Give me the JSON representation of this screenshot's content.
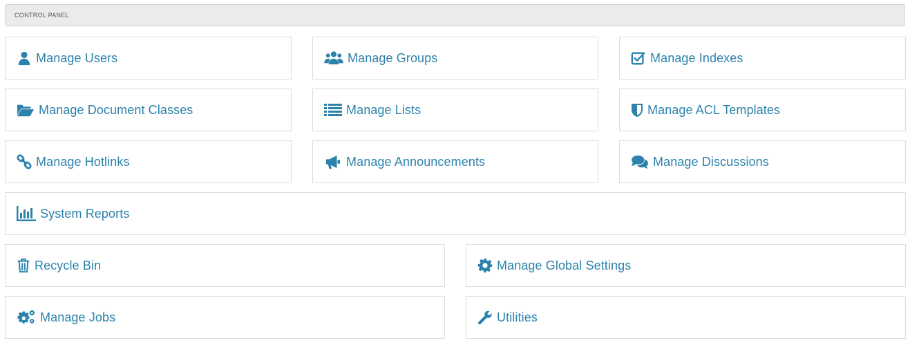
{
  "header": {
    "title": "CONTROL PANEL"
  },
  "accent_color": "#2c82ab",
  "tiles": [
    {
      "label": "Manage Users",
      "icon": "user-icon"
    },
    {
      "label": "Manage Groups",
      "icon": "users-group-icon"
    },
    {
      "label": "Manage Indexes",
      "icon": "checkbox-icon"
    },
    {
      "label": "Manage Document Classes",
      "icon": "folder-open-icon"
    },
    {
      "label": "Manage Lists",
      "icon": "list-icon"
    },
    {
      "label": "Manage ACL Templates",
      "icon": "shield-icon"
    },
    {
      "label": "Manage Hotlinks",
      "icon": "link-icon"
    },
    {
      "label": "Manage Announcements",
      "icon": "megaphone-icon"
    },
    {
      "label": "Manage Discussions",
      "icon": "comments-icon"
    },
    {
      "label": "System Reports",
      "icon": "bar-chart-icon"
    },
    {
      "label": "Recycle Bin",
      "icon": "trash-icon"
    },
    {
      "label": "Manage Global Settings",
      "icon": "gear-icon"
    },
    {
      "label": "Manage Jobs",
      "icon": "gears-icon"
    },
    {
      "label": "Utilities",
      "icon": "wrench-icon"
    }
  ]
}
